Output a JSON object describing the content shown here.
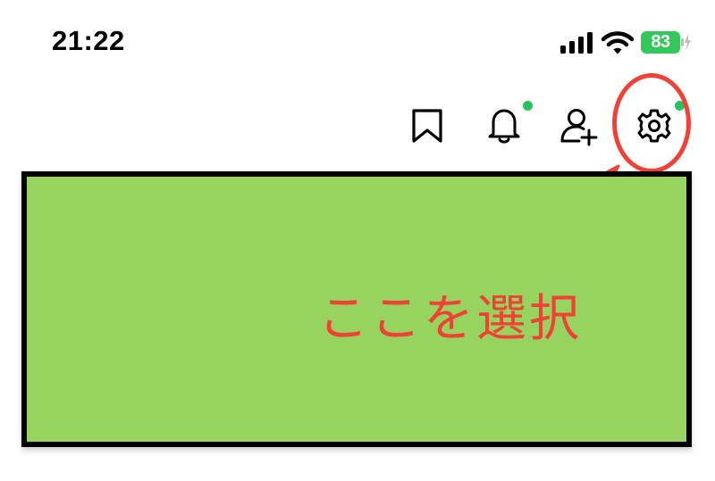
{
  "status_bar": {
    "time": "21:22",
    "battery_level": "83",
    "battery_color": "#34c759"
  },
  "toolbar": {
    "icons": [
      {
        "name": "bookmark-icon",
        "has_dot": false
      },
      {
        "name": "bell-icon",
        "has_dot": true
      },
      {
        "name": "add-friend-icon",
        "has_dot": true
      },
      {
        "name": "gear-icon",
        "has_dot": true
      }
    ],
    "dot_color": "#22c55e"
  },
  "banner": {
    "fill_color": "#96d35f"
  },
  "annotation": {
    "text": "ここを選択",
    "color": "#f24036"
  }
}
